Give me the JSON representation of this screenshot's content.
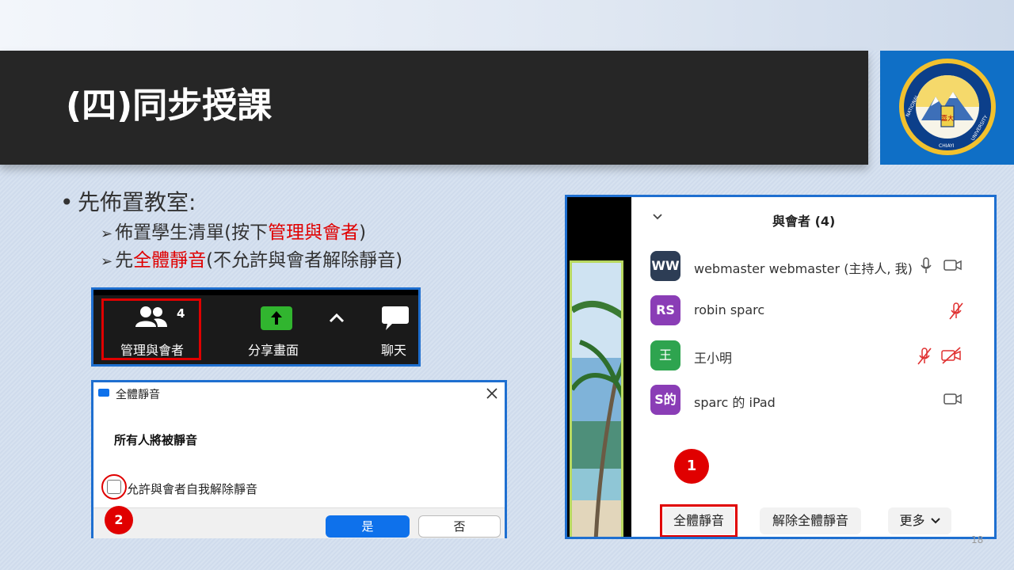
{
  "slide": {
    "title": "(四)同步授課",
    "bullet": "先佈置教室:",
    "sub1_prefix": "佈置學生清單(按下",
    "sub1_highlight": "管理與會者",
    "sub1_suffix": ")",
    "sub2_prefix": "先",
    "sub2_highlight": "全體靜音",
    "sub2_suffix": "(不允許與會者解除靜音)",
    "page_number": "18"
  },
  "logo": {
    "text_left": "NATIONAL",
    "text_bottom": "CHIAYI",
    "text_right": "UNIVERSITY",
    "seal_text": "嘉大"
  },
  "toolbar": {
    "participants_count": "4",
    "participants_label": "管理與會者",
    "share_label": "分享畫面",
    "chat_label": "聊天"
  },
  "dialog": {
    "title": "全體靜音",
    "heading": "所有人將被靜音",
    "checkbox_label": "允許與會者自我解除靜音",
    "yes_label": "是",
    "no_label": "否",
    "badge": "2"
  },
  "panel": {
    "header": "與會者 (4)",
    "participants": [
      {
        "initials": "WW",
        "name": "webmaster webmaster (主持人, 我)",
        "color": "#2d3d55"
      },
      {
        "initials": "RS",
        "name": "robin sparc",
        "color": "#8a3db6"
      },
      {
        "initials": "王",
        "name": "王小明",
        "color": "#2ea44f"
      },
      {
        "initials": "S的",
        "name": "sparc 的 iPad",
        "color": "#8a3db6"
      }
    ],
    "badge": "1",
    "mute_all_label": "全體靜音",
    "unmute_all_label": "解除全體靜音",
    "more_label": "更多"
  },
  "colors": {
    "accent_red": "#e00000",
    "zoom_blue": "#0e71eb",
    "title_bar": "#262626"
  }
}
